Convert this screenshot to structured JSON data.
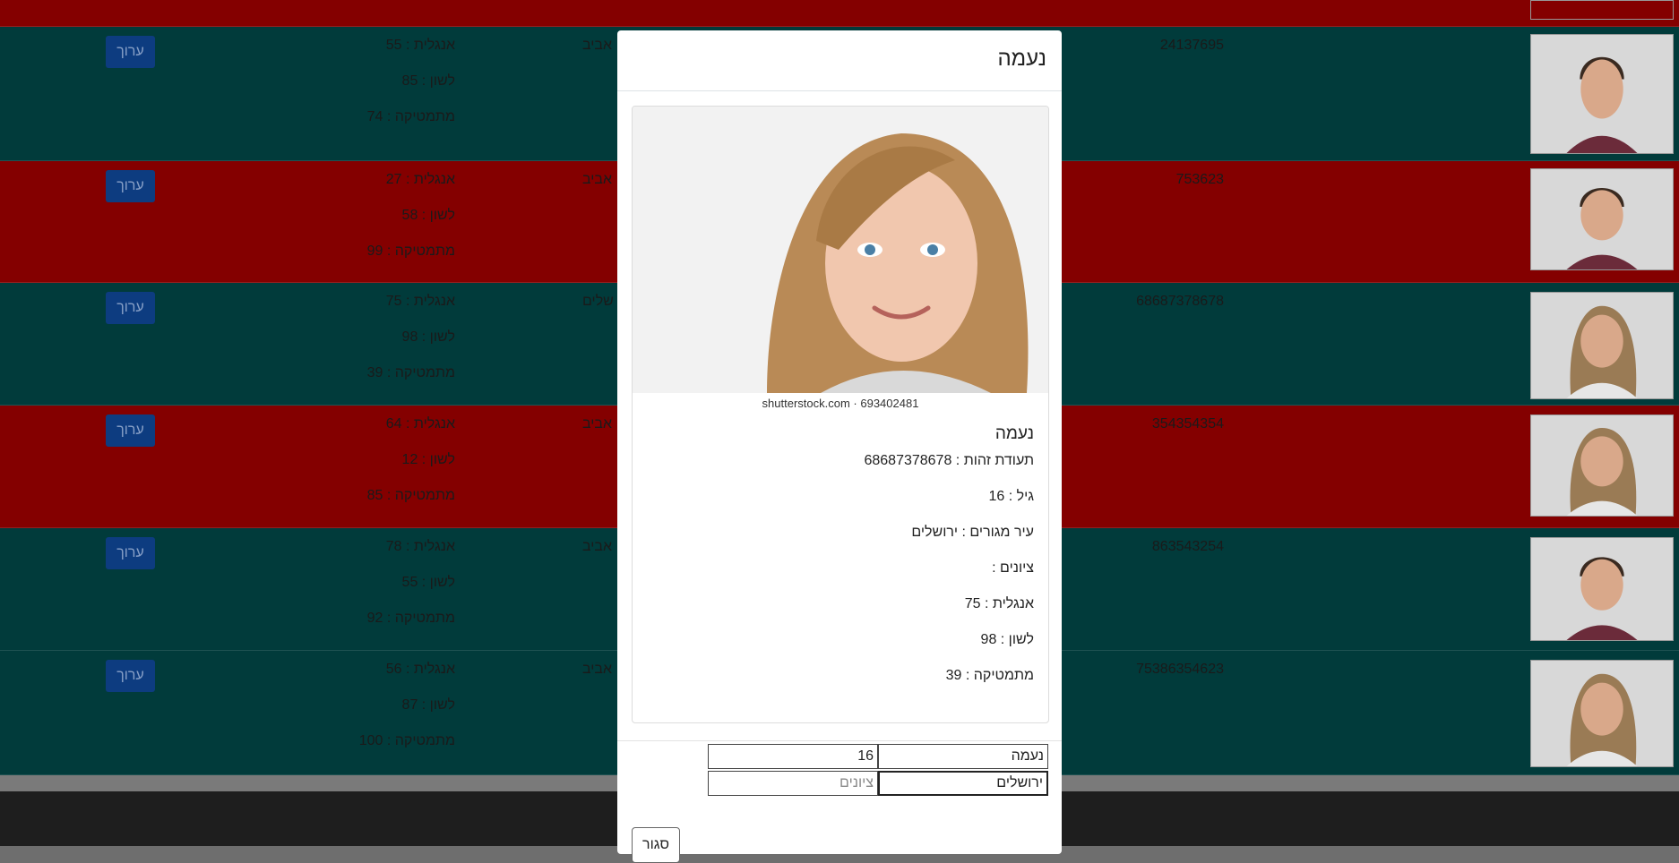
{
  "table": {
    "edit_label": "ערוך",
    "rows": [
      {
        "id": "24137695",
        "city": "אביב",
        "grades": [
          "אנגלית : 55",
          "לשון : 85",
          "מתמטיקה : 74"
        ],
        "color": "green",
        "photo": "male-student-photo"
      },
      {
        "id": "753623",
        "city": "אביב",
        "grades": [
          "אנגלית : 27",
          "לשון : 58",
          "מתמטיקה : 99"
        ],
        "color": "red",
        "photo": "male-student-photo"
      },
      {
        "id": "68687378678",
        "city": "שלים",
        "grades": [
          "אנגלית : 75",
          "לשון : 98",
          "מתמטיקה : 39"
        ],
        "color": "green",
        "photo": "female-student-photo"
      },
      {
        "id": "354354354",
        "city": "אביב",
        "grades": [
          "אנגלית : 64",
          "לשון : 12",
          "מתמטיקה : 85"
        ],
        "color": "red",
        "photo": "female-student-photo"
      },
      {
        "id": "863543254",
        "city": "אביב",
        "grades": [
          "אנגלית : 78",
          "לשון : 55",
          "מתמטיקה : 92"
        ],
        "color": "green",
        "photo": "male-student-photo"
      },
      {
        "id": "75386354623",
        "city": "אביב",
        "grades": [
          "אנגלית : 56",
          "לשון : 87",
          "מתמטיקה : 100"
        ],
        "color": "green",
        "photo": "female-student-photo"
      }
    ]
  },
  "modal": {
    "title": "נעמה",
    "image_caption": "shutterstock.com · 693402481",
    "card": {
      "name": "נעמה",
      "id_line": "תעודת זהות : 68687378678",
      "age_line": "גיל : 16",
      "city_line": "עיר מגורים : ירושלים",
      "grades_line": "ציונים :",
      "english_line": "אנגלית : 75",
      "lashon_line": "לשון : 98",
      "math_line": "מתמטיקה : 39"
    },
    "form": {
      "name_value": "נעמה",
      "age_value": "16",
      "city_value": "ירושלים",
      "grades_placeholder": "ציונים"
    },
    "close_label": "סגור"
  },
  "colors": {
    "row_green": "#013b3b",
    "row_red": "#840000",
    "edit_button": "#0d3c80",
    "backdrop": "#6e6e6e",
    "footer": "#1e1e1e"
  }
}
